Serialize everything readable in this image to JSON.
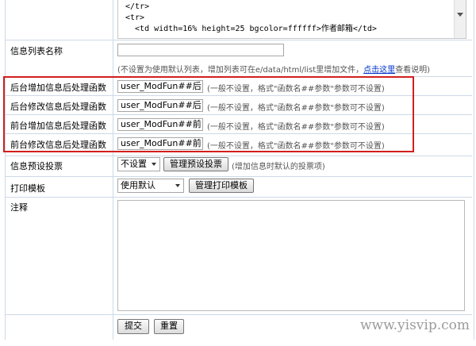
{
  "code_lines": [
    "</tr>",
    "<tr>",
    "  <td width=16% height=25 bgcolor=ffffff>作者邮箱</td>"
  ],
  "list_name": {
    "label": "信息列表名称",
    "value": "",
    "hint_prefix": "(不设置为使用默认列表，增加列表可在e/data/html/list里增加文件，",
    "hint_link": "点击这里",
    "hint_suffix": "查看说明)"
  },
  "func_rows": [
    {
      "label": "后台增加信息后处理函数",
      "value": "user_ModFun##后台增",
      "hint": "(一般不设置，格式\"函数名##参数\"参数可不设置)"
    },
    {
      "label": "后台修改信息后处理函数",
      "value": "user_ModFun##后台修",
      "hint": "(一般不设置，格式\"函数名##参数\"参数可不设置)"
    },
    {
      "label": "前台增加信息后处理函数",
      "value": "user_ModFun##前台增",
      "hint": "(一般不设置，格式\"函数名##参数\"参数可不设置)"
    },
    {
      "label": "前台修改信息后处理函数",
      "value": "user_ModFun##前台修",
      "hint": "(一般不设置，格式\"函数名##参数\"参数可不设置)"
    }
  ],
  "vote": {
    "label": "信息预设投票",
    "selected": "不设置",
    "button": "管理预设投票",
    "hint": "(增加信息时默认的投票项)"
  },
  "print": {
    "label": "打印模板",
    "selected": "使用默认",
    "button": "管理打印模板"
  },
  "note": {
    "label": "注释",
    "value": ""
  },
  "actions": {
    "submit": "提交",
    "reset": "重置"
  },
  "watermark": "www.yisvip.com",
  "colors": {
    "highlight": "#d0201d",
    "border": "#cdd9e6",
    "link": "#0033cc"
  }
}
